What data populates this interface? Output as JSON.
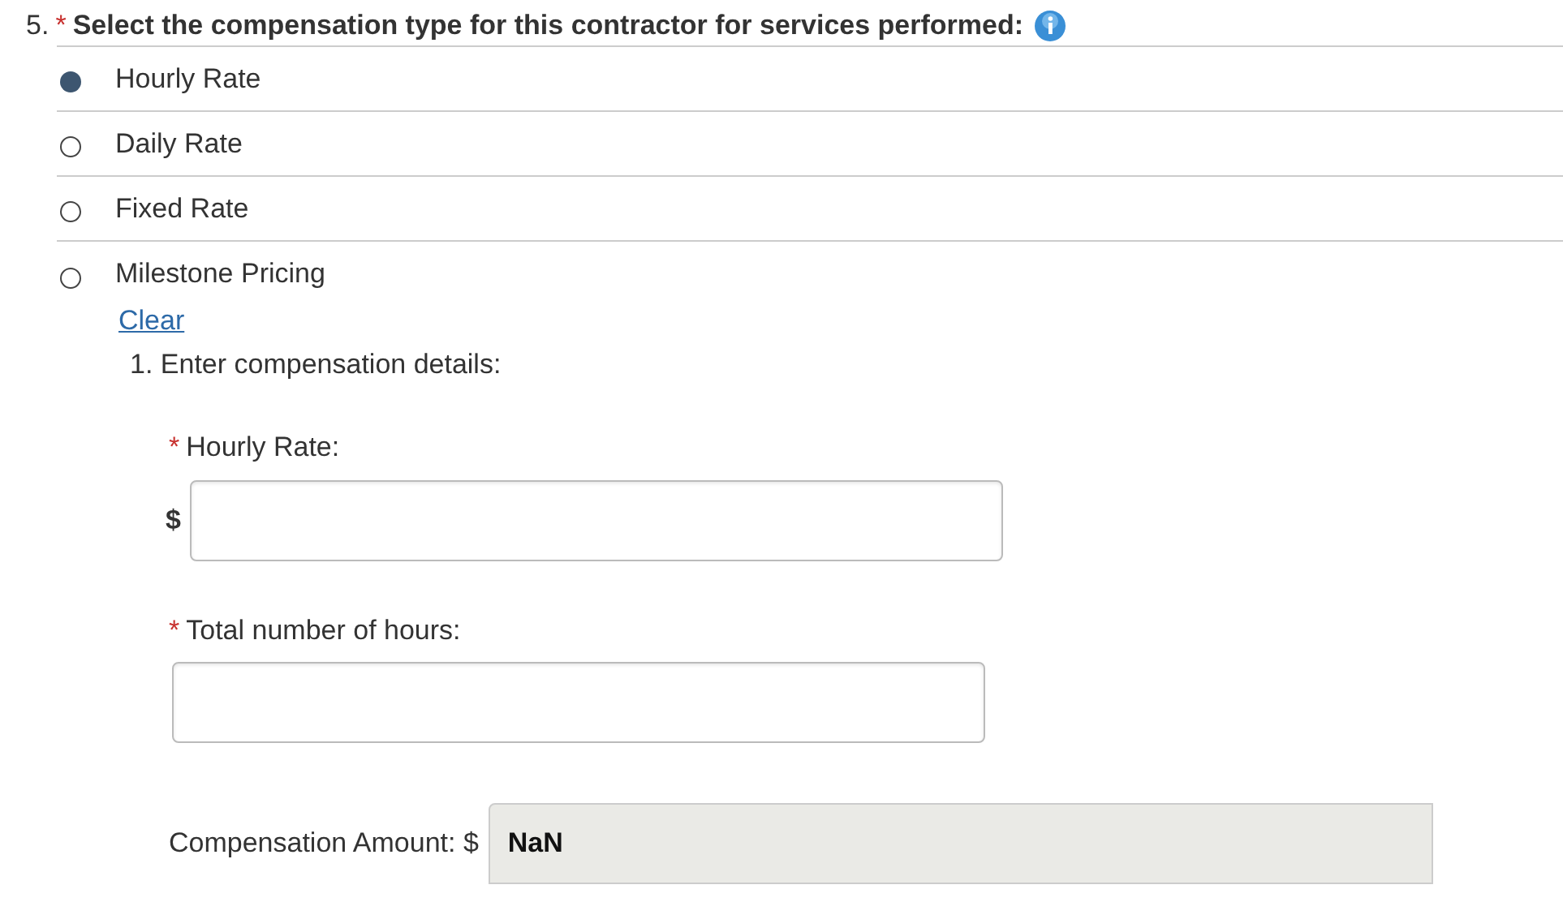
{
  "question": {
    "number": "5.",
    "required_mark": "*",
    "text": "Select the compensation type for this contractor for services performed:"
  },
  "options": [
    {
      "label": "Hourly Rate",
      "selected": true
    },
    {
      "label": "Daily Rate",
      "selected": false
    },
    {
      "label": "Fixed Rate",
      "selected": false
    },
    {
      "label": "Milestone Pricing",
      "selected": false
    }
  ],
  "clear_link": "Clear",
  "sub_question": "1. Enter compensation details:",
  "fields": [
    {
      "required_mark": "*",
      "label": "Hourly Rate:",
      "prefix": "$"
    },
    {
      "required_mark": "*",
      "label": "Total number of hours:"
    }
  ],
  "compensation": {
    "label": "Compensation Amount: $",
    "value": "NaN"
  }
}
